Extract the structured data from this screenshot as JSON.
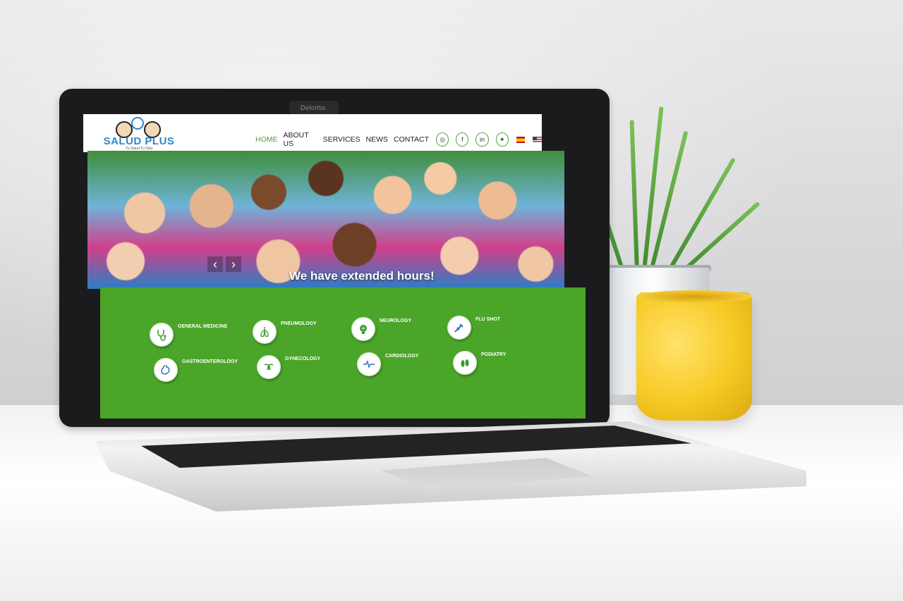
{
  "camera_brand": "Deloitte.",
  "site": {
    "logo_text": "SALUD PLUS",
    "logo_tagline": "Tu Salud Tu Vida",
    "nav": [
      {
        "label": "HOME",
        "active": true
      },
      {
        "label": "ABOUT US",
        "active": false
      },
      {
        "label": "SERVICES",
        "active": false
      },
      {
        "label": "NEWS",
        "active": false
      },
      {
        "label": "CONTACT",
        "active": false
      }
    ],
    "social_icons": [
      "instagram-icon",
      "facebook-icon",
      "linkedin-icon",
      "twitter-icon"
    ],
    "languages": [
      "Spanish",
      "English"
    ],
    "hero_caption": "We have extended hours!",
    "services": [
      {
        "label": "GENERAL MEDICINE",
        "icon": "stethoscope-icon"
      },
      {
        "label": "PNEUMOLOGY",
        "icon": "lungs-icon"
      },
      {
        "label": "NEUROLOGY",
        "icon": "brain-icon"
      },
      {
        "label": "FLU SHOT",
        "icon": "syringe-icon"
      },
      {
        "label": "GASTROENTEROLOGY",
        "icon": "stomach-icon"
      },
      {
        "label": "GYNECOLOGY",
        "icon": "uterus-icon"
      },
      {
        "label": "CARDIOLOGY",
        "icon": "heartbeat-icon"
      },
      {
        "label": "PODIATRY",
        "icon": "feet-icon"
      }
    ]
  },
  "colors": {
    "brand_green": "#4aa529",
    "logo_blue": "#2f88c7",
    "nav_active": "#4aa63a",
    "cup_yellow": "#f6c924"
  }
}
